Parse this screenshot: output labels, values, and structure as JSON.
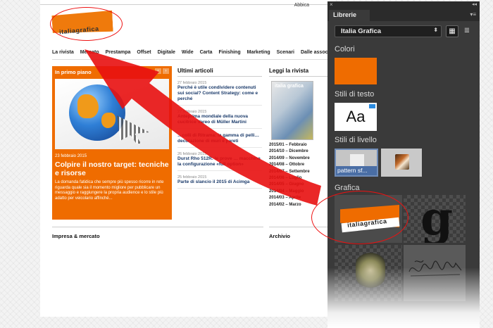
{
  "site": {
    "toplink": "Abbica",
    "logo_text": "italiagrafica",
    "nav": [
      "La rivista",
      "Mercato",
      "Prestampa",
      "Offset",
      "Digitale",
      "Wide",
      "Carta",
      "Finishing",
      "Marketing",
      "Scenari",
      "Dalle associazioni"
    ],
    "primo": {
      "title": "In primo piano",
      "prev": "‹",
      "next": "›",
      "date": "23 febbraio 2015",
      "headline": "Colpire il nostro target: tecniche e risorse",
      "desc": "La domanda fatidica che sempre più spesso ricorre in rete riguarda quale sia il momento migliore per pubblicare un messaggio e raggiungere la propria audience e lo stile più adatto per veicolario affinché..."
    },
    "ultimi": {
      "title": "Ultimi articoli",
      "articles": [
        {
          "date": "27 febbraio 2015",
          "text": "Perché è utile condividere contenuti sui social? Content Strategy: come e perché"
        },
        {
          "date": "27 febbraio 2015",
          "text": "Anteprima mondiale della nuova cucitrice Vareo di Müller Martini"
        },
        {
          "date": "",
          "text": "…colli di Ritrama: la gamma di pelli… decorazione di muri e pareti"
        },
        {
          "date": "26 febbraio 2015",
          "text": "Durst Rho 512R: le prove … macchine la configurazione «full option»"
        },
        {
          "date": "25 febbraio 2015",
          "text": "Parte di slancio il 2015 di Acimga"
        }
      ]
    },
    "leggi": {
      "title": "Leggi la rivista",
      "cover_title": "italia grafica",
      "issues": [
        "2015/01 – Febbraio",
        "2014/10 – Dicembre",
        "2014/09 – Novembre",
        "2014/08 – Ottobre",
        "2014/07 – Settembre",
        "2014/06 – Luglio",
        "2014/05 – Giugno",
        "2014/04 – Maggio",
        "2014/03 – Aprile",
        "2014/02 – Marzo"
      ]
    },
    "impresa": "Impresa & mercato",
    "archivio": "Archivio"
  },
  "panel": {
    "close": "×",
    "collapse": "◂◂",
    "tab": "Librerie",
    "menu": "▾≡",
    "library": "Italia Grafica",
    "select_arrow": "⬍",
    "view_grid": "▦",
    "view_list": "≣",
    "sections": {
      "colori": "Colori",
      "stili_testo": "Stili di testo",
      "stili_livello": "Stili di livello",
      "grafica": "Grafica"
    },
    "text_style_sample": "Aa",
    "layer_style_label": "pattern sf...",
    "graphic_logo_text": "italiagrafica",
    "graphic_letter": "g"
  },
  "colors": {
    "brand_orange": "#ef6c00",
    "annotation_red": "#e11111",
    "panel_bg": "#3a3a3a"
  }
}
